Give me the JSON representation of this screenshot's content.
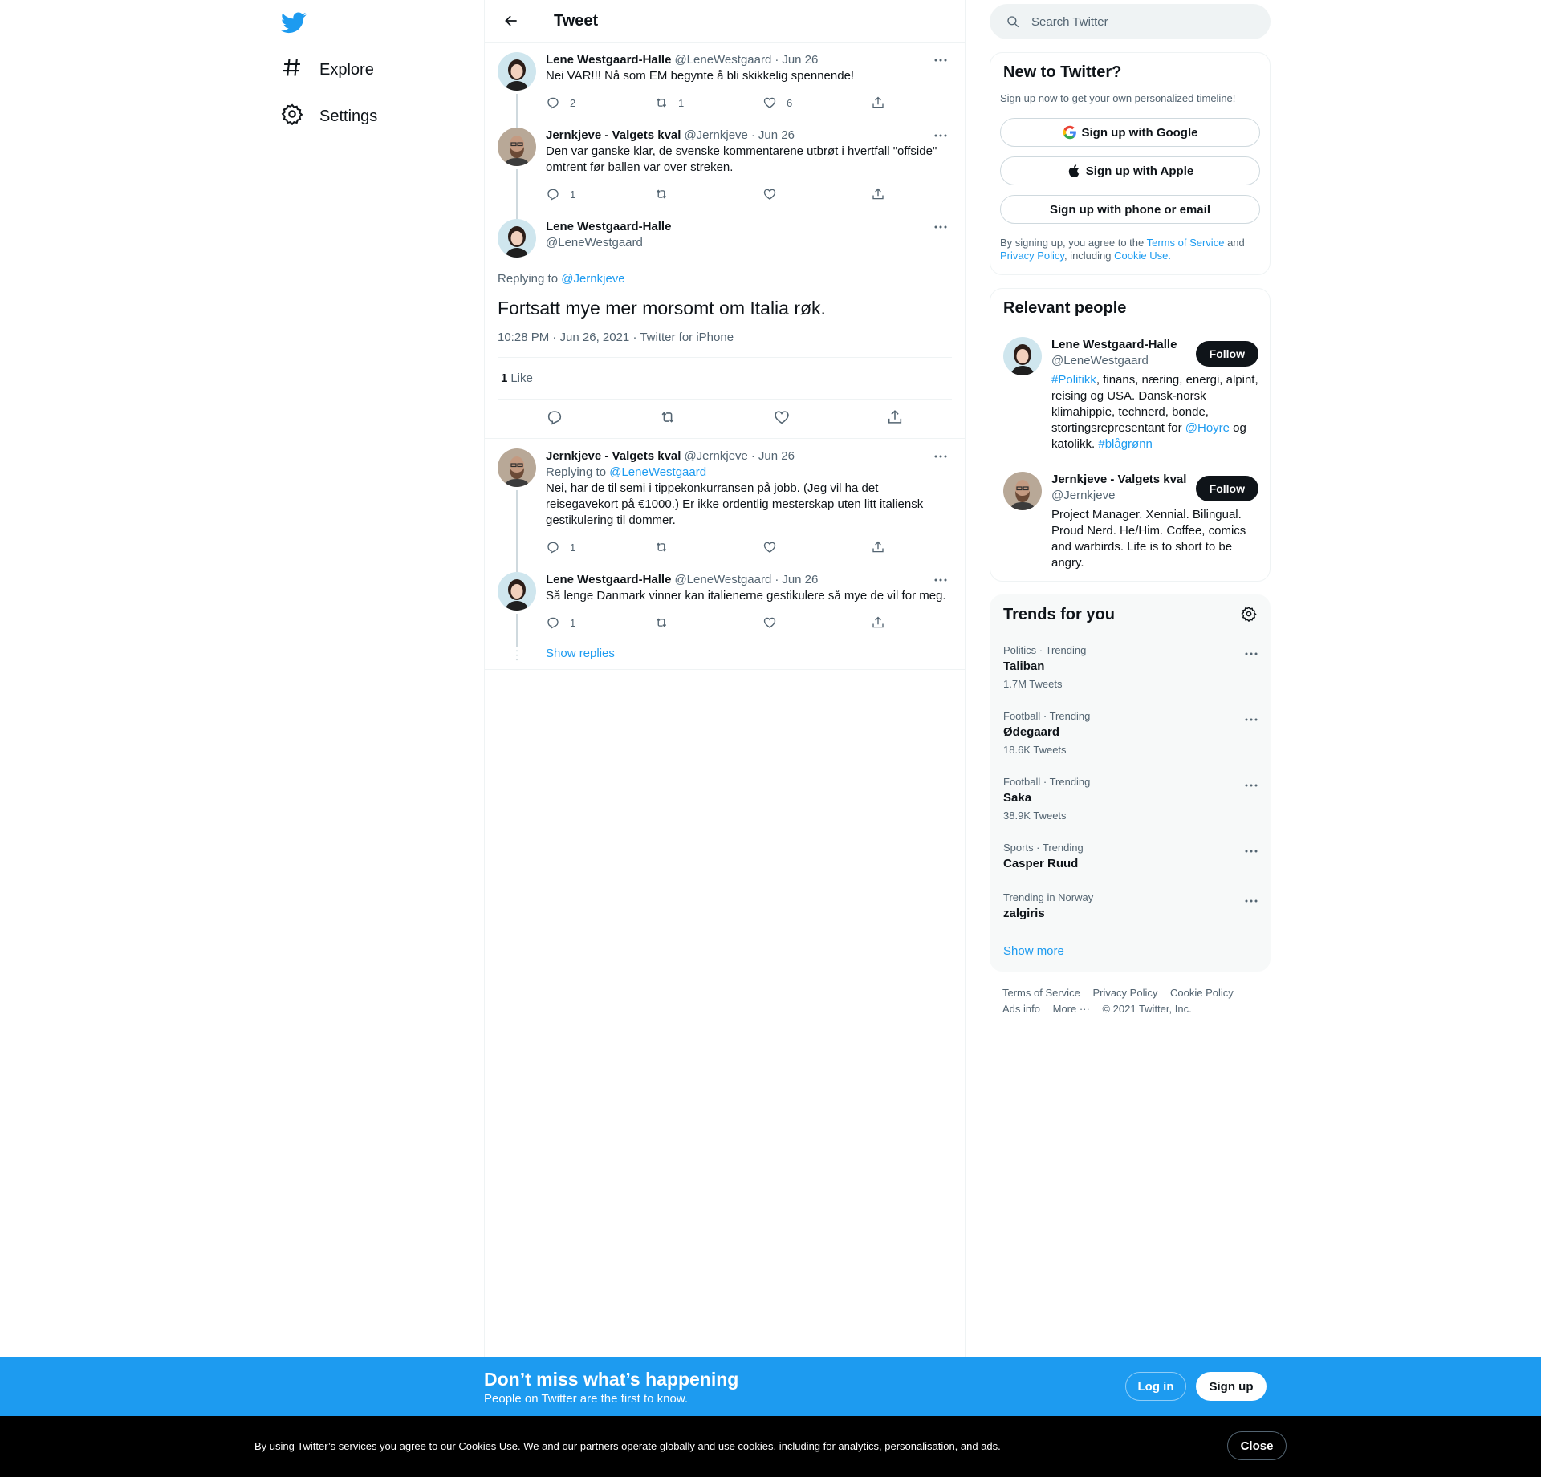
{
  "nav": {
    "logo_icon": "twitter-bird-icon",
    "items": [
      {
        "label": "Explore",
        "icon": "hashtag-icon"
      },
      {
        "label": "Settings",
        "icon": "gear-icon"
      }
    ]
  },
  "header": {
    "title": "Tweet"
  },
  "thread": [
    {
      "name": "Lene Westgaard-Halle",
      "handle": "@LeneWestgaard",
      "dot": "·",
      "date": "Jun 26",
      "text": "Nei VAR!!! Nå som EM begynte å bli skikkelig spennende!",
      "replies": "2",
      "retweets": "1",
      "likes": "6"
    },
    {
      "name": "Jernkjeve - Valgets kval",
      "handle": "@Jernkjeve",
      "dot": "·",
      "date": "Jun 26",
      "text": "Den var ganske klar, de svenske kommentarene utbrøt i hvertfall \"offside\"\nomtrent før ballen var over streken.",
      "replies": "1",
      "retweets": "",
      "likes": ""
    }
  ],
  "focus": {
    "name": "Lene Westgaard-Halle",
    "handle": "@LeneWestgaard",
    "replying_prefix": "Replying to",
    "replying_to": "@Jernkjeve",
    "text": "Fortsatt mye mer morsomt om Italia røk.",
    "meta": "10:28 PM · Jun 26, 2021 · Twitter for iPhone",
    "like_count": "1",
    "like_label": "Like"
  },
  "replies": [
    {
      "name": "Jernkjeve - Valgets kval",
      "handle": "@Jernkjeve",
      "dot": "·",
      "date": "Jun 26",
      "replying_prefix": "Replying to",
      "replying_to": "@LeneWestgaard",
      "text": "Nei, har de til semi i tippekonkurransen på jobb. (Jeg vil ha det\nreisegavekort på €1000.) Er ikke ordentlig mesterskap uten litt italiensk\ngestikulering til dommer.",
      "replies": "1"
    },
    {
      "name": "Lene Westgaard-Halle",
      "handle": "@LeneWestgaard",
      "dot": "·",
      "date": "Jun 26",
      "text": "Så lenge Danmark vinner kan italienerne gestikulere så mye de vil for meg.",
      "replies": "1"
    }
  ],
  "show_replies": "Show replies",
  "search": {
    "placeholder": "Search Twitter"
  },
  "new_to_twitter": {
    "title": "New to Twitter?",
    "subtitle": "Sign up now to get your own personalized timeline!",
    "google": "Sign up with Google",
    "apple": "Sign up with Apple",
    "phone": "Sign up with phone or email",
    "legal_1": "By signing up, you agree to the",
    "terms": "Terms of Service",
    "and": "and",
    "privacy": "Privacy Policy",
    "including": ", including",
    "cookie": "Cookie Use."
  },
  "relevant": {
    "title": "Relevant people",
    "follow": "Follow",
    "people": [
      {
        "name": "Lene Westgaard-Halle",
        "handle": "@LeneWestgaard",
        "bio_tag1": "#Politikk",
        "bio_1": ", finans, næring, energi, alpint, reising og USA. Dansk-norsk klimahippie, technerd, bonde, stortingsrepresentant for ",
        "bio_tag2": "@Hoyre",
        "bio_2": " og katolikk. ",
        "bio_tag3": "#blågrønn"
      },
      {
        "name": "Jernkjeve - Valgets kval",
        "handle": "@Jernkjeve",
        "bio": "Project Manager. Xennial. Bilingual. Proud Nerd. He/Him. Coffee, comics and warbirds. Life is to short to be angry."
      }
    ]
  },
  "trends": {
    "title": "Trends for you",
    "items": [
      {
        "meta": "Politics · Trending",
        "name": "Taliban",
        "count": "1.7M Tweets"
      },
      {
        "meta": "Football · Trending",
        "name": "Ødegaard",
        "count": "18.6K Tweets"
      },
      {
        "meta": "Football · Trending",
        "name": "Saka",
        "count": "38.9K Tweets"
      },
      {
        "meta": "Sports · Trending",
        "name": "Casper Ruud",
        "count": ""
      },
      {
        "meta": "Trending in Norway",
        "name": "zalgiris",
        "count": ""
      }
    ],
    "show_more": "Show more"
  },
  "footer": {
    "terms": "Terms of Service",
    "privacy": "Privacy Policy",
    "cookie": "Cookie Policy",
    "ads": "Ads info",
    "more": "More ···",
    "copyright": "© 2021 Twitter, Inc."
  },
  "bottom_bar": {
    "title": "Don’t miss what’s happening",
    "subtitle": "People on Twitter are the first to know.",
    "login": "Log in",
    "signup": "Sign up"
  },
  "cookie_bar": {
    "text": "By using Twitter’s services you agree to our Cookies Use. We and our partners operate globally and use cookies, including for analytics, personalisation, and ads.",
    "close": "Close"
  },
  "colors": {
    "accent": "#1d9bf0",
    "text": "#0f1419",
    "muted": "#536471"
  }
}
